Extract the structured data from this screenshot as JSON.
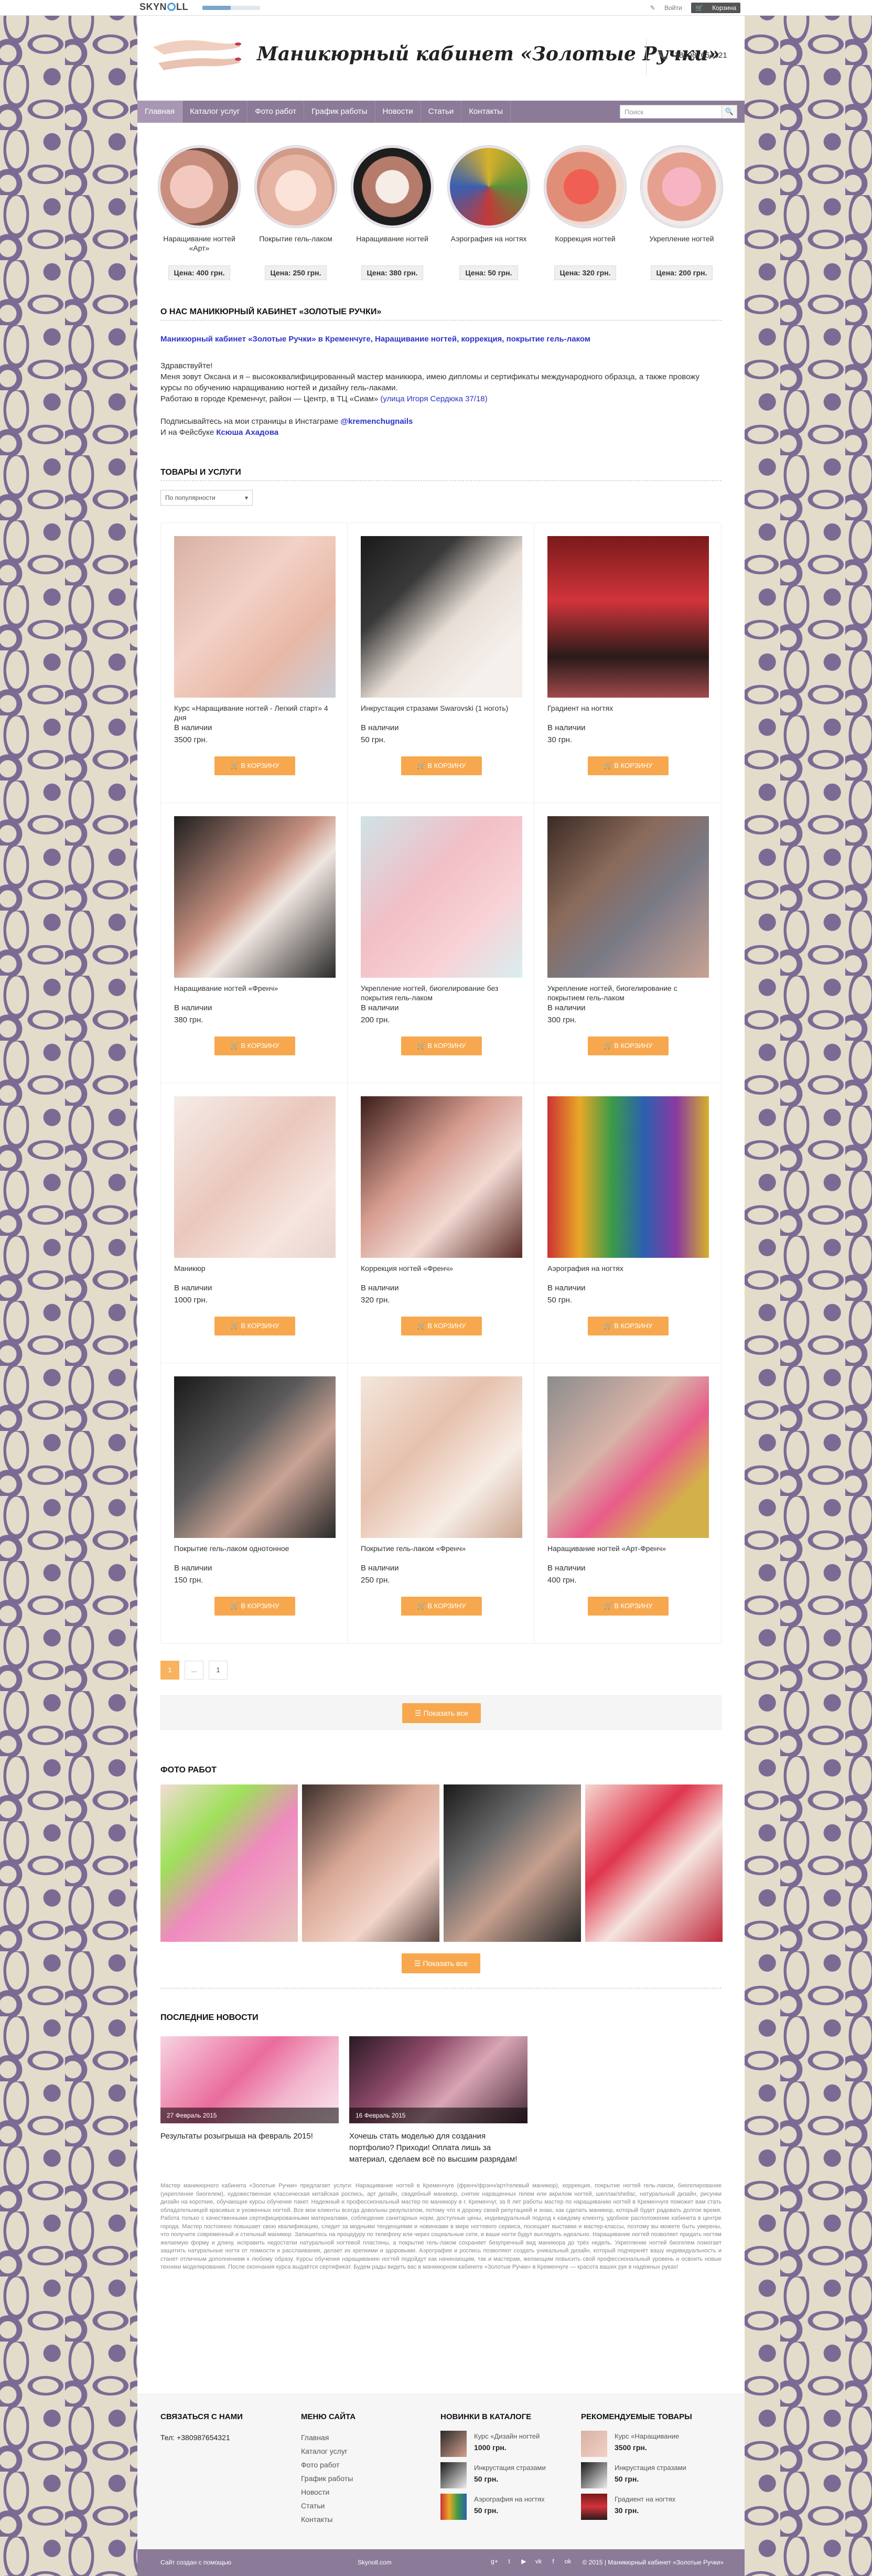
{
  "topbar": {
    "brand_left": "SKYN",
    "brand_right": "LL",
    "login": "Войти",
    "cart": "Корзина"
  },
  "header": {
    "title": "Маникюрный кабинет «Золотые Ручки»",
    "phone": "+380987654321"
  },
  "nav": {
    "items": [
      "Главная",
      "Каталог услуг",
      "Фото работ",
      "График работы",
      "Новости",
      "Статьи",
      "Контакты"
    ],
    "search_placeholder": "Поиск"
  },
  "categories": [
    {
      "label": "Наращивание ногтей «Арт»",
      "price": "Цена: 400 грн."
    },
    {
      "label": "Покрытие гель-лаком",
      "price": "Цена: 250 грн."
    },
    {
      "label": "Наращивание ногтей",
      "price": "Цена: 380 грн."
    },
    {
      "label": "Аэрография на ногтях",
      "price": "Цена: 50 грн."
    },
    {
      "label": "Коррекция ногтей",
      "price": "Цена: 320 грн."
    },
    {
      "label": "Укрепление ногтей",
      "price": "Цена: 200 грн."
    }
  ],
  "about": {
    "heading": "О НАС МАНИКЮРНЫЙ КАБИНЕТ «ЗОЛОТЫЕ РУЧКИ»",
    "link": "Маникюрный кабинет «Золотые Ручки» в Кременчуге, Наращивание ногтей, коррекция, покрытие гель-лаком",
    "greeting": "Здравствуйте!",
    "p1": "Меня зовут Оксана и я – высококвалифицированный мастер маникюра, имею дипломы и сертификаты международного образца, а также провожу курсы по обучению наращиванию ногтей и дизайну гель-лаками.",
    "p2": "Работаю в городе Кременчуг, район — Центр, в ТЦ «Сиам»",
    "p2_link": "(улица Игоря Сердюка 37/18)",
    "p3": "Подписывайтесь на мои страницы в Инстаграме",
    "insta": "@kremenchugnails",
    "p4": "И на Фейсбуке",
    "fb": "Ксюша Ахадова"
  },
  "products_heading": "ТОВАРЫ И УСЛУГИ",
  "sort_label": "По популярности",
  "products": [
    {
      "name": "Курс «Наращивание ногтей - Легкий старт» 4 дня",
      "stock": "В наличии",
      "price": "3500 грн.",
      "buy": "В КОРЗИНУ"
    },
    {
      "name": "Инкрустация стразами Swarovski (1 ноготь)",
      "stock": "В наличии",
      "price": "50 грн.",
      "buy": "В КОРЗИНУ"
    },
    {
      "name": "Градиент на ногтях",
      "stock": "В наличии",
      "price": "30 грн.",
      "buy": "В КОРЗИНУ"
    },
    {
      "name": "Наращивание ногтей «Френч»",
      "stock": "В наличии",
      "price": "380 грн.",
      "buy": "В КОРЗИНУ"
    },
    {
      "name": "Укрепление ногтей, биогелирование без покрытия гель-лаком",
      "stock": "В наличии",
      "price": "200 грн.",
      "buy": "В КОРЗИНУ"
    },
    {
      "name": "Укрепление ногтей, биогелирование с покрытием гель-лаком",
      "stock": "В наличии",
      "price": "300 грн.",
      "buy": "В КОРЗИНУ"
    },
    {
      "name": "Маникюр",
      "stock": "В наличии",
      "price": "1000 грн.",
      "buy": "В КОРЗИНУ"
    },
    {
      "name": "Коррекция ногтей «Френч»",
      "stock": "В наличии",
      "price": "320 грн.",
      "buy": "В КОРЗИНУ"
    },
    {
      "name": "Аэрография на ногтях",
      "stock": "В наличии",
      "price": "50 грн.",
      "buy": "В КОРЗИНУ"
    },
    {
      "name": "Покрытие гель-лаком однотонное",
      "stock": "В наличии",
      "price": "150 грн.",
      "buy": "В КОРЗИНУ"
    },
    {
      "name": "Покрытие гель-лаком «Френч»",
      "stock": "В наличии",
      "price": "250 грн.",
      "buy": "В КОРЗИНУ"
    },
    {
      "name": "Наращивание ногтей «Арт-Френч»",
      "stock": "В наличии",
      "price": "400 грн.",
      "buy": "В КОРЗИНУ"
    }
  ],
  "pager": {
    "current": "1",
    "dots": "...",
    "last": "1"
  },
  "show_all": "Показать все",
  "photos_heading": "ФОТО РАБОТ",
  "news_heading": "ПОСЛЕДНИЕ НОВОСТИ",
  "news": [
    {
      "date": "27 Февраль 2015",
      "title": "Результаты розыгрыша на февраль 2015!"
    },
    {
      "date": "16 Февраль 2015",
      "title": "Хочешь стать моделью для создания портфолио? Приходи! Оплата лишь за материал, сделаем всё по высшим разрядам!"
    }
  ],
  "seo_text": "Мастер маникюрного кабинета «Золотые Ручки» предлагает услуги: Наращивание ногтей в Кременчуге (френч/фрэнч/арт/гелевый маникюр), коррекция, покрытие ногтей гель-лаком, биогелирование (укрепление биогелем), художественная классическая китайская роспись, арт дизайн, свадебный маникюр, снятие наращенных гелем или акрилом ногтей, шеллак/shellac, натуральный дизайн, рисунки дизайн на короткие, обучающие курсы обучение пакет. Надежный и профессиональный мастер по маникюру в г. Кременчуг, за 8 лет работы мастер по наращиванию ногтей в Кременчуге поможет вам стать обладательницей красивых и ухоженных ногтей. Все мои клиенты всегда довольны результатом, потому что я дорожу своей репутацией и знаю, как сделать маникюр, который будет радовать долгое время. Работа только с качественными сертифицированными материалами, соблюдение санитарных норм, доступные цены, индивидуальный подход к каждому клиенту, удобное расположение кабинета в центре города. Мастер постоянно повышает свою квалификацию, следит за модными тенденциями и новинками в мире ногтевого сервиса, посещает выставки и мастер-классы, поэтому вы можете быть уверены, что получите современный и стильный маникюр. Запишитесь на процедуру по телефону или через социальные сети, и ваши ногти будут выглядеть идеально. Наращивание ногтей позволяет придать ногтям желаемую форму и длину, исправить недостатки натуральной ногтевой пластины, а покрытие гель-лаком сохраняет безупречный вид маникюра до трёх недель. Укрепление ногтей биогелем помогает защитить натуральные ногти от ломкости и расслаивания, делает их крепкими и здоровыми. Аэрография и роспись позволяют создать уникальный дизайн, который подчеркнёт вашу индивидуальность и станет отличным дополнением к любому образу. Курсы обучения наращиванию ногтей подойдут как начинающим, так и мастерам, желающим повысить свой профессиональный уровень и освоить новые техники моделирования. После окончания курса выдаётся сертификат. Будем рады видеть вас в маникюрном кабинете «Золотые Ручки» в Кременчуге — красота ваших рук в надёжных руках!",
  "footer": {
    "contact_heading": "СВЯЗАТЬСЯ С НАМИ",
    "contact_phone": "Тел: +380987654321",
    "menu_heading": "МЕНЮ САЙТА",
    "menu": [
      "Главная",
      "Каталог услуг",
      "Фото работ",
      "График работы",
      "Новости",
      "Статьи",
      "Контакты"
    ],
    "new_heading": "НОВИНКИ В КАТАЛОГЕ",
    "new_items": [
      {
        "name": "Курс «Дизайн ногтей",
        "price": "1000 грн."
      },
      {
        "name": "Инкрустация стразами",
        "price": "50 грн."
      },
      {
        "name": "Аэрография на ногтях",
        "price": "50 грн."
      }
    ],
    "rec_heading": "РЕКОМЕНДУЕМЫЕ ТОВАРЫ",
    "rec_items": [
      {
        "name": "Курс «Наращивание",
        "price": "3500 грн."
      },
      {
        "name": "Инкрустация стразами",
        "price": "50 грн."
      },
      {
        "name": "Градиент на ногтях",
        "price": "30 грн."
      }
    ]
  },
  "bottom": {
    "left": "Сайт создан с помощью",
    "center": "Skynoll.com",
    "right": "© 2015 | Маникюрный кабинет «Золотые Ручки»"
  }
}
